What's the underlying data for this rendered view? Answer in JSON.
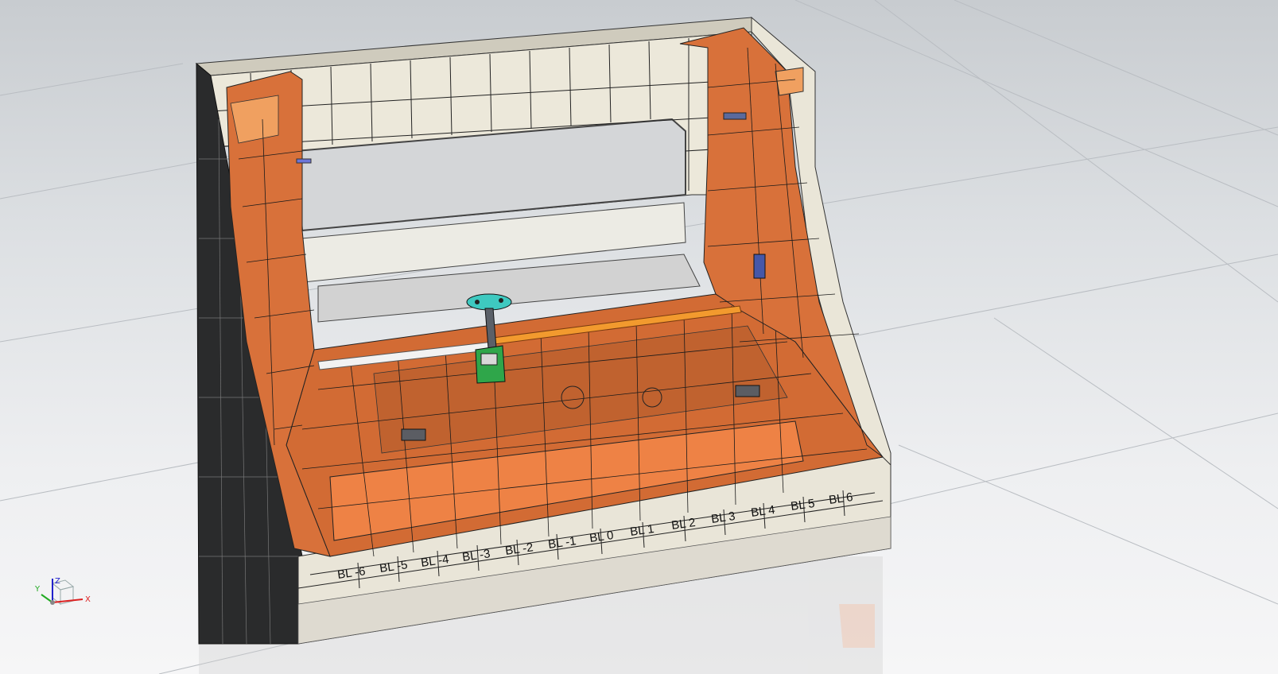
{
  "viewport": {
    "background_top": "#c8ccd0",
    "background_bottom": "#f6f6f7"
  },
  "model": {
    "part_color": "#d9703a",
    "fixture_color": "#e8e4d8",
    "bl_labels": [
      "BL -6",
      "BL -5",
      "BL -4",
      "BL -3",
      "BL -2",
      "BL -1",
      "BL 0",
      "BL 1",
      "BL 2",
      "BL 3",
      "BL 4",
      "BL 5",
      "BL 6"
    ]
  },
  "triad": {
    "x": "X",
    "y": "Y",
    "z": "Z",
    "x_color": "#d22",
    "y_color": "#2a2",
    "z_color": "#22c"
  }
}
